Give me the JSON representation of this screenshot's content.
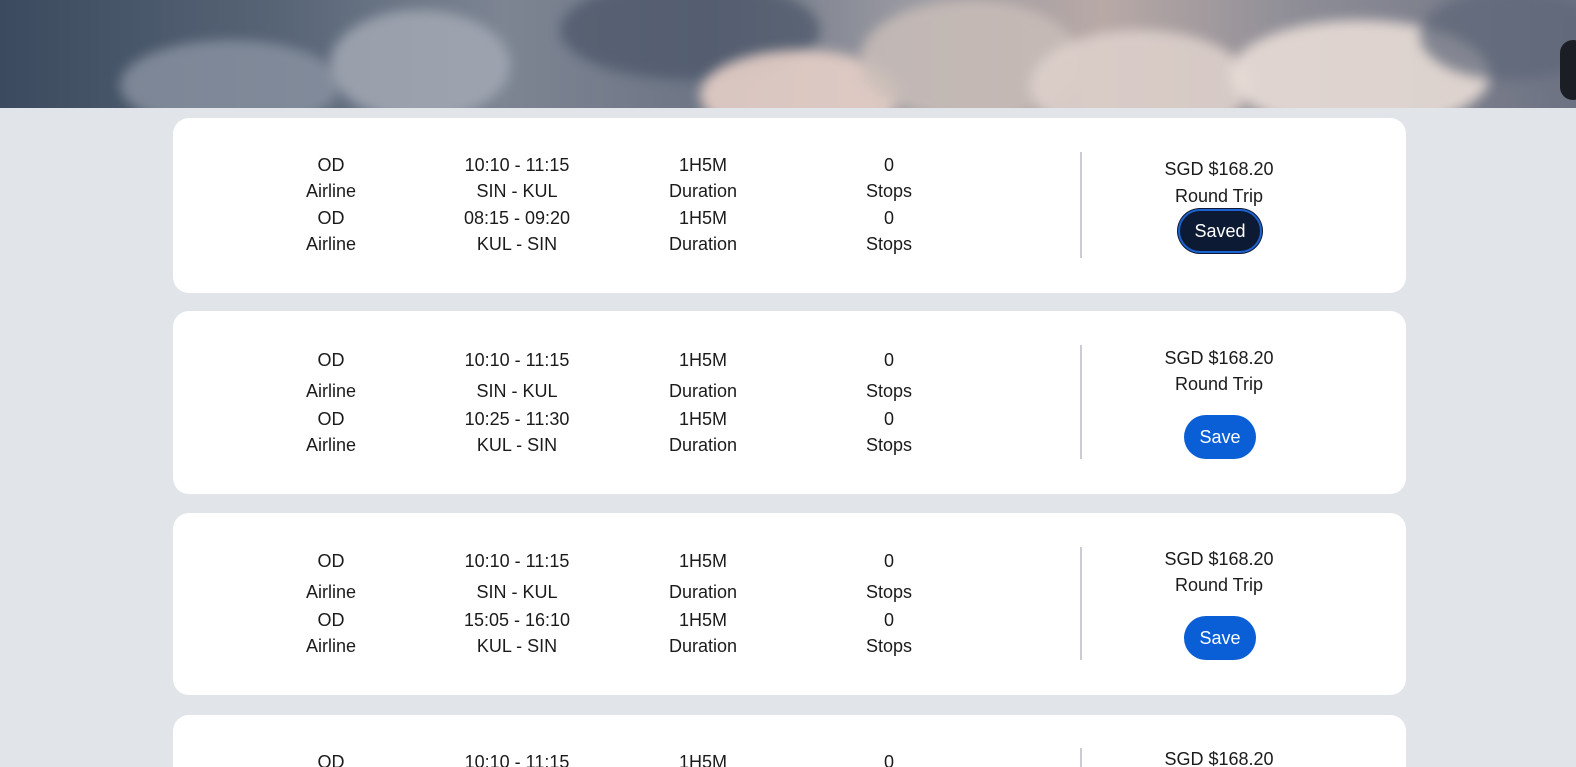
{
  "colors": {
    "page_bg": "#e1e5ea",
    "card_bg": "#ffffff",
    "save_button": "#0a5fd6",
    "saved_button": "#0c1a33"
  },
  "cards": [
    {
      "outbound": {
        "airline_code": "OD",
        "airline_label": "Airline",
        "time": "10:10 - 11:15",
        "route": "SIN - KUL",
        "duration": "1H5M",
        "duration_label": "Duration",
        "stops": "0",
        "stops_label": "Stops"
      },
      "inbound": {
        "airline_code": "OD",
        "airline_label": "Airline",
        "time": "08:15 - 09:20",
        "route": "KUL - SIN",
        "duration": "1H5M",
        "duration_label": "Duration",
        "stops": "0",
        "stops_label": "Stops"
      },
      "price": "SGD $168.20",
      "trip_type": "Round Trip",
      "button_label": "Saved",
      "saved": true
    },
    {
      "outbound": {
        "airline_code": "OD",
        "airline_label": "Airline",
        "time": "10:10 - 11:15",
        "route": "SIN - KUL",
        "duration": "1H5M",
        "duration_label": "Duration",
        "stops": "0",
        "stops_label": "Stops"
      },
      "inbound": {
        "airline_code": "OD",
        "airline_label": "Airline",
        "time": "10:25 - 11:30",
        "route": "KUL - SIN",
        "duration": "1H5M",
        "duration_label": "Duration",
        "stops": "0",
        "stops_label": "Stops"
      },
      "price": "SGD $168.20",
      "trip_type": "Round Trip",
      "button_label": "Save",
      "saved": false
    },
    {
      "outbound": {
        "airline_code": "OD",
        "airline_label": "Airline",
        "time": "10:10 - 11:15",
        "route": "SIN - KUL",
        "duration": "1H5M",
        "duration_label": "Duration",
        "stops": "0",
        "stops_label": "Stops"
      },
      "inbound": {
        "airline_code": "OD",
        "airline_label": "Airline",
        "time": "15:05 - 16:10",
        "route": "KUL - SIN",
        "duration": "1H5M",
        "duration_label": "Duration",
        "stops": "0",
        "stops_label": "Stops"
      },
      "price": "SGD $168.20",
      "trip_type": "Round Trip",
      "button_label": "Save",
      "saved": false
    },
    {
      "outbound": {
        "airline_code": "OD",
        "time": "10:10 - 11:15",
        "duration": "1H5M",
        "stops": "0"
      },
      "price": "SGD $168.20"
    }
  ]
}
